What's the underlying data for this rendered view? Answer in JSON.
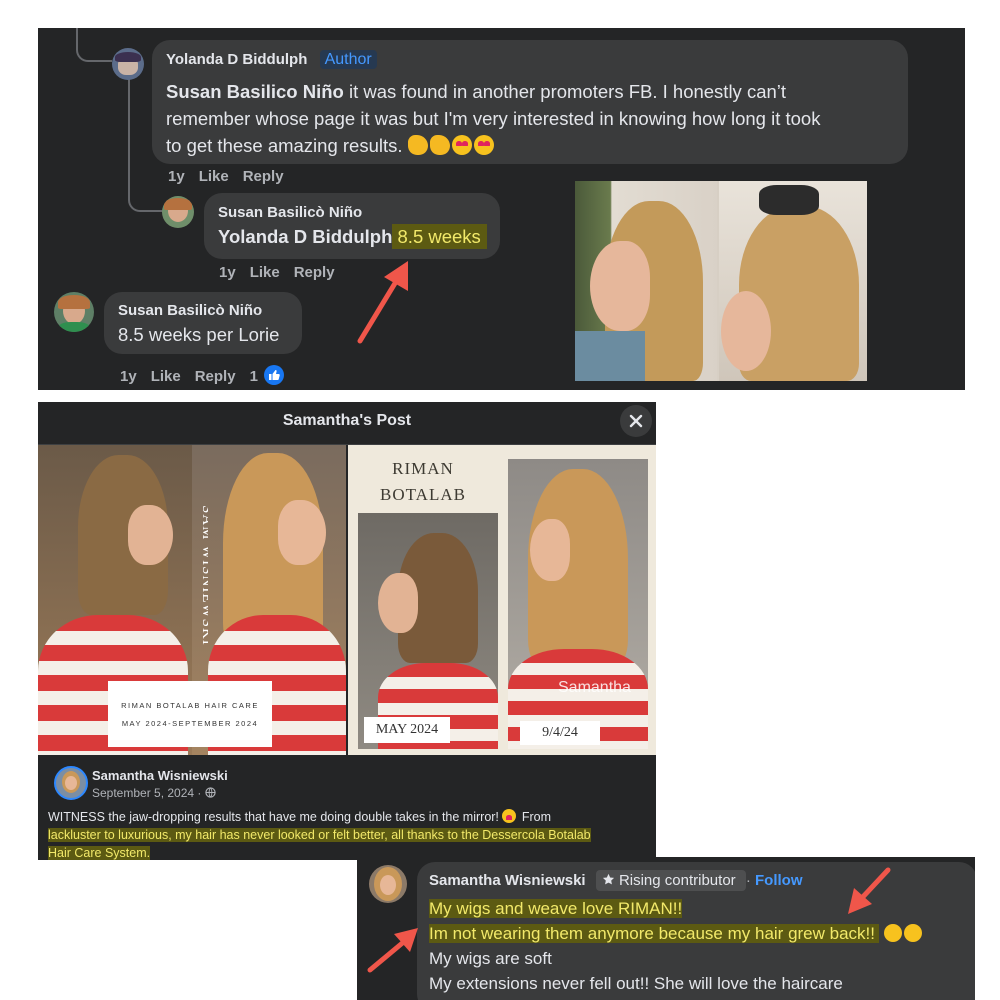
{
  "comments_panel": {
    "comment1": {
      "author": "Yolanda D Biddulph",
      "badge": "Author",
      "mention": "Susan Basilico Niño",
      "text_line1": " it was found in another promoters FB. I honestly can’t",
      "text_line2": "remember whose page it was but I'm very interested in knowing how long it took",
      "text_line3": "to get these amazing results.",
      "time": "1y",
      "like": "Like",
      "reply": "Reply"
    },
    "reply1": {
      "author": "Susan Basilicò Niño",
      "mention": "Yolanda D Biddulph",
      "highlight": " 8.5 weeks",
      "time": "1y",
      "like": "Like",
      "reply": "Reply"
    },
    "comment2": {
      "author": "Susan Basilicò Niño",
      "text": "8.5 weeks per Lorie",
      "time": "1y",
      "like": "Like",
      "reply": "Reply",
      "reaction_count": "1"
    }
  },
  "post_panel": {
    "title": "Samantha's Post",
    "image_left": {
      "watermark": "SAM WISNIEWSKI",
      "card_title": "RIMAN BOTALAB HAIR CARE",
      "card_dates": "MAY 2024-SEPTEMBER 2024"
    },
    "image_right": {
      "title_line1": "RIMAN",
      "title_line2": "BOTALAB",
      "label_before": "MAY 2024",
      "label_after": "9/4/24",
      "watermark": "Samantha"
    },
    "author": "Samantha Wisniewski",
    "date": "September 5, 2024 ·",
    "text_line1": "WITNESS the jaw-dropping results that have me doing double takes in the mirror!",
    "text_line1b": " From",
    "text_line2": "lackluster to luxurious, my hair has never looked or felt better, all thanks to the Dessercola Botalab",
    "text_line3": "Hair Care System."
  },
  "bottom_comment": {
    "author": "Samantha Wisniewski",
    "badge": "Rising contributor",
    "follow_sep": " · ",
    "follow": "Follow",
    "line1": "My wigs and weave love RIMAN!!",
    "line2a": "Im not wearing them anymore because ",
    "line2b": "my hair grew back!!",
    "line3": "My wigs are soft",
    "line4": "My extensions never fell out!! She will love the haircare"
  },
  "colors": {
    "panel_bg": "#242526",
    "bubble_bg": "#3a3b3c",
    "author_badge": "#4599ff",
    "highlight_bg": "#5c5a12",
    "highlight_text": "#f2e96a",
    "arrow": "#f0564a"
  },
  "icons": [
    "close-icon",
    "globe-icon",
    "star-badge-icon",
    "like-reaction-icon",
    "arrow-annotation"
  ]
}
